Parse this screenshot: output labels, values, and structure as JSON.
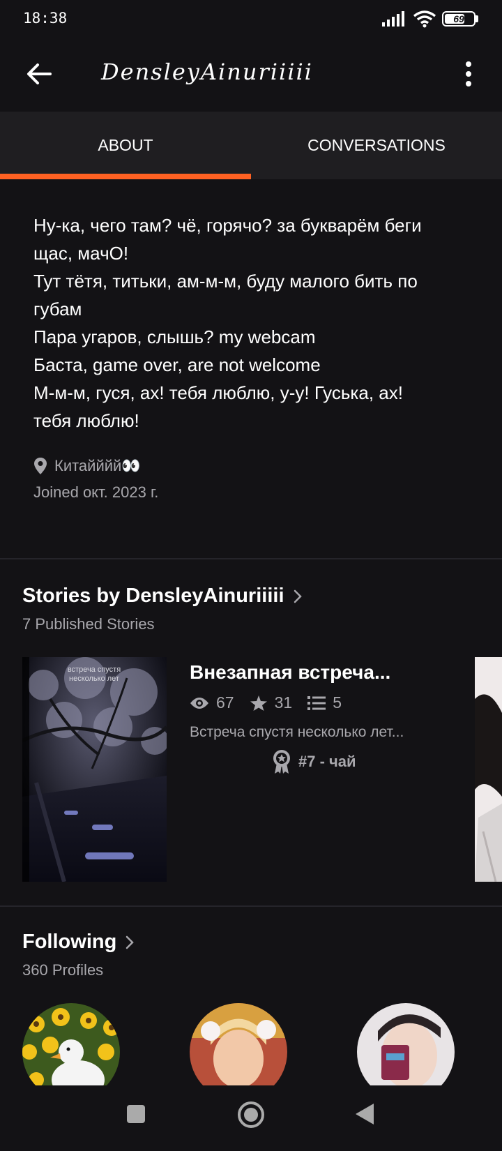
{
  "status_bar": {
    "time": "18:38",
    "battery": "69",
    "battery_level": 0.69
  },
  "header": {
    "title": "DensleyAinuriiiii"
  },
  "tabs": [
    {
      "label": "ABOUT",
      "active": true
    },
    {
      "label": "CONVERSATIONS",
      "active": false
    }
  ],
  "accent_color": "#ff6122",
  "about": {
    "bio_lines": [
      "Ну-ка, чего там? чё, горячо? за букварём беги",
      "щас, мачО!",
      "Тут тётя, титьки, ам-м-м, буду малого бить по",
      "губам",
      "Пара угаров, слышь? my webcam",
      "Баста, game over, are not welcome",
      "М-м-м, гуся, ах! тебя люблю, у-у! Гуська, ах!",
      "тебя люблю!"
    ],
    "location": "Китайййй👀",
    "joined": "Joined окт. 2023 г."
  },
  "stories": {
    "title": "Stories by DensleyAinuriiiii",
    "subtitle": "7 Published Stories",
    "items": [
      {
        "cover_text": "встреча спустя несколько лет",
        "title": "Внезапная встреча...",
        "views": "67",
        "votes": "31",
        "parts": "5",
        "description": "Встреча спустя несколько лет...",
        "rank": "#7 - чай"
      }
    ]
  },
  "following": {
    "title": "Following",
    "subtitle": "360 Profiles"
  },
  "icons": [
    "back-arrow-icon",
    "more-vert-icon",
    "location-pin-icon",
    "eye-icon",
    "star-icon",
    "list-icon",
    "rank-badge-icon",
    "chevron-right-icon"
  ]
}
